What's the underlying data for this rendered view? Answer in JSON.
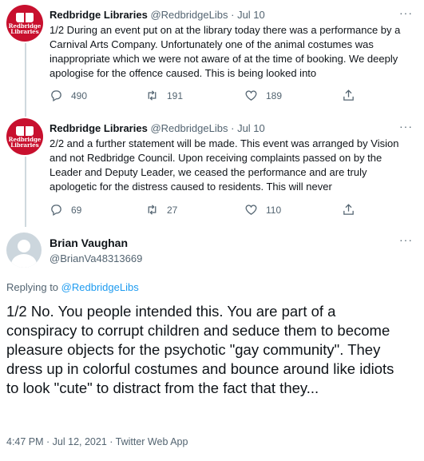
{
  "tweets": [
    {
      "name": "Redbridge Libraries",
      "handle": "@RedbridgeLibs",
      "date": "Jul 10",
      "body": "1/2 During an event put on at the library today there was a performance by a Carnival Arts Company. Unfortunately one of the animal costumes was inappropriate which we were not aware of at the time of booking. We deeply apologise for the offence caused. This is being looked into",
      "replies": "490",
      "retweets": "191",
      "likes": "189"
    },
    {
      "name": "Redbridge Libraries",
      "handle": "@RedbridgeLibs",
      "date": "Jul 10",
      "body": "2/2 and a further statement will be made. This event was arranged by Vision and not Redbridge Council. Upon receiving complaints passed on by the Leader and Deputy Leader, we ceased the performance and are truly apologetic for the distress caused to residents. This will never",
      "replies": "69",
      "retweets": "27",
      "likes": "110"
    }
  ],
  "avatar_text": [
    "Redbridge",
    "Libraries"
  ],
  "main": {
    "name": "Brian Vaughan",
    "handle": "@BrianVa48313669",
    "replying_prefix": "Replying to",
    "replying_handle": "@RedbridgeLibs",
    "text": "1/2 No. You people intended this. You are part of a conspiracy to corrupt children and seduce them to become pleasure objects for the psychotic \"gay community\". They dress up in colorful costumes and bounce around like idiots to look \"cute\" to distract from the fact that they...",
    "footer": "4:47 PM · Jul 12, 2021 · Twitter Web App"
  },
  "more_glyph": "···",
  "meta_sep": "·",
  "colors": {
    "accent": "#1d9bf0",
    "avatar_brand": "#c8102e",
    "muted": "#536471"
  }
}
